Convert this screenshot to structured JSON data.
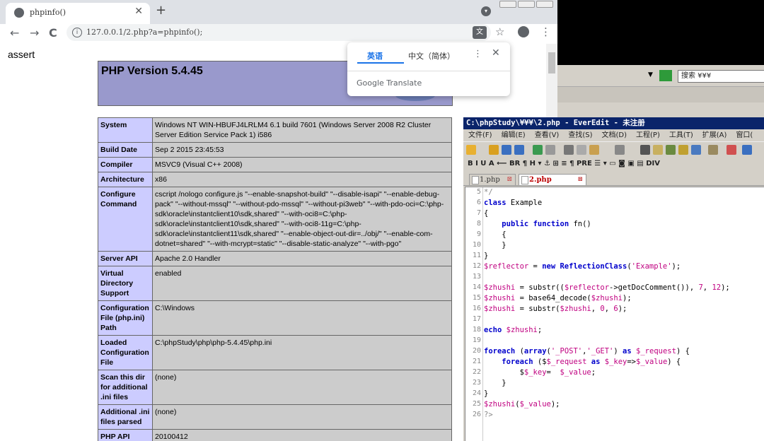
{
  "browser": {
    "tab_title": "phpinfo()",
    "tab_close": "✕",
    "new_tab": "+",
    "back": "←",
    "forward": "→",
    "reload": "C",
    "url": "127.0.0.1/2.php?a=phpinfo();",
    "star": "☆",
    "menu": "⋮"
  },
  "page": {
    "assert_text": "assert",
    "php_version": "PHP Version 5.4.45",
    "rows": [
      {
        "k": "System",
        "v": "Windows NT WIN-HBUFJ4LRLM4 6.1 build 7601 (Windows Server 2008 R2 Cluster Server Edition Service Pack 1) i586"
      },
      {
        "k": "Build Date",
        "v": "Sep 2 2015 23:45:53"
      },
      {
        "k": "Compiler",
        "v": "MSVC9 (Visual C++ 2008)"
      },
      {
        "k": "Architecture",
        "v": "x86"
      },
      {
        "k": "Configure Command",
        "v": "cscript /nologo configure.js \"--enable-snapshot-build\" \"--disable-isapi\" \"--enable-debug-pack\" \"--without-mssql\" \"--without-pdo-mssql\" \"--without-pi3web\" \"--with-pdo-oci=C:\\php-sdk\\oracle\\instantclient10\\sdk,shared\" \"--with-oci8=C:\\php-sdk\\oracle\\instantclient10\\sdk,shared\" \"--with-oci8-11g=C:\\php-sdk\\oracle\\instantclient11\\sdk,shared\" \"--enable-object-out-dir=../obj/\" \"--enable-com-dotnet=shared\" \"--with-mcrypt=static\" \"--disable-static-analyze\" \"--with-pgo\""
      },
      {
        "k": "Server API",
        "v": "Apache 2.0 Handler"
      },
      {
        "k": "Virtual Directory Support",
        "v": "enabled"
      },
      {
        "k": "Configuration File (php.ini) Path",
        "v": "C:\\Windows"
      },
      {
        "k": "Loaded Configuration File",
        "v": "C:\\phpStudy\\php\\php-5.4.45\\php.ini"
      },
      {
        "k": "Scan this dir for additional .ini files",
        "v": "(none)"
      },
      {
        "k": "Additional .ini files parsed",
        "v": "(none)"
      },
      {
        "k": "PHP API",
        "v": "20100412"
      }
    ]
  },
  "translate": {
    "lang_english": "英语",
    "lang_chinese": "中文（简体）",
    "more": "⋮",
    "close": "✕",
    "brand": "Google Translate"
  },
  "desktop": {
    "search_text": "搜索 ¥¥¥"
  },
  "editor": {
    "title": "C:\\phpStudy\\¥¥¥\\2.php - EverEdit - 未注册",
    "menu": [
      "文件(F)",
      "编辑(E)",
      "查看(V)",
      "查找(S)",
      "文档(D)",
      "工程(P)",
      "工具(T)",
      "扩展(A)",
      "窗口("
    ],
    "format_bar": "B  I  U  A  ⟵ BR ¶  H ▾  ⚓ ⊞ ≡ ¶ PRE ☰ ▾  ▭ ◙ ▣ ▤ DIV",
    "tab1": "1.php",
    "tab2": "2.php",
    "tab_close": "⊠",
    "line_numbers": [
      "5",
      "6",
      "7",
      "8",
      "9",
      "10",
      "11",
      "12",
      "13",
      "14",
      "15",
      "16",
      "17",
      "18",
      "19",
      "20",
      "21",
      "22",
      "23",
      "24",
      "25",
      "26"
    ]
  },
  "colors": {
    "php_header": "#9999cc",
    "php_key": "#ccccff",
    "php_value": "#cccccc",
    "editor_title": "#0a246a"
  }
}
